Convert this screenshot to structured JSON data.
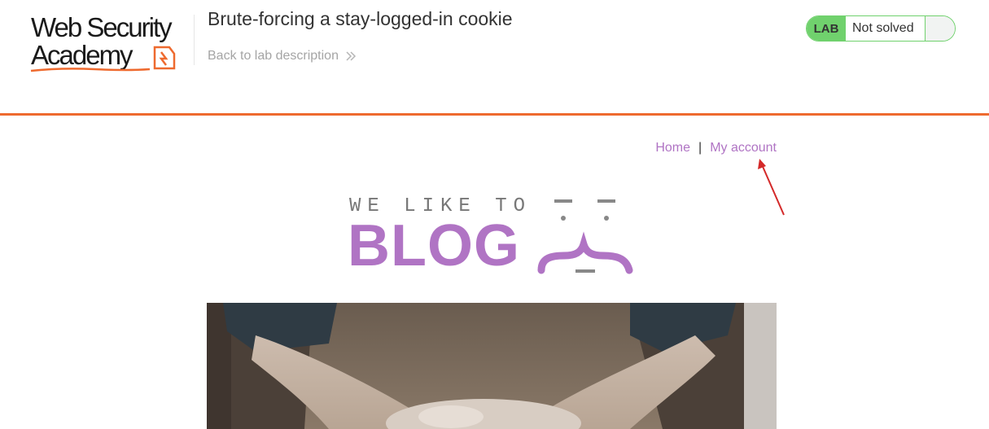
{
  "academy": {
    "logo_line1": "Web Security",
    "logo_line2": "Academy",
    "lab_title": "Brute-forcing a stay-logged-in cookie",
    "back_link": "Back to lab description",
    "lab_badge": "LAB",
    "lab_status": "Not solved",
    "accent_color": "#ee6a2f",
    "status_color": "#70d16d"
  },
  "nav": {
    "home": "Home",
    "separator": "|",
    "my_account": "My account",
    "link_color": "#b074c4"
  },
  "banner": {
    "small_text": "WE LIKE TO",
    "big_text": "BLOG",
    "accent_color": "#b074c4"
  },
  "post": {
    "image_icon": "hands-with-clay-photo"
  }
}
